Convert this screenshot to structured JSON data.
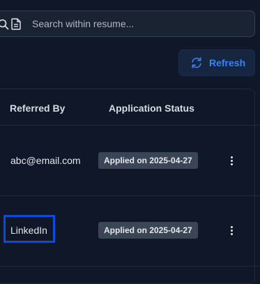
{
  "search": {
    "placeholder": "Search within resume...",
    "value": ""
  },
  "toolbar": {
    "refresh_label": "Refresh"
  },
  "table": {
    "columns": [
      "Referred By",
      "Application Status"
    ],
    "rows": [
      {
        "referred_by": "abc@email.com",
        "status": "Applied on 2025-04-27"
      },
      {
        "referred_by": "LinkedIn",
        "status": "Applied on 2025-04-27"
      }
    ]
  },
  "colors": {
    "background": "#0f1729",
    "accent": "#3b82f6",
    "badge": "#3a4556",
    "highlight": "#0d4be0"
  }
}
